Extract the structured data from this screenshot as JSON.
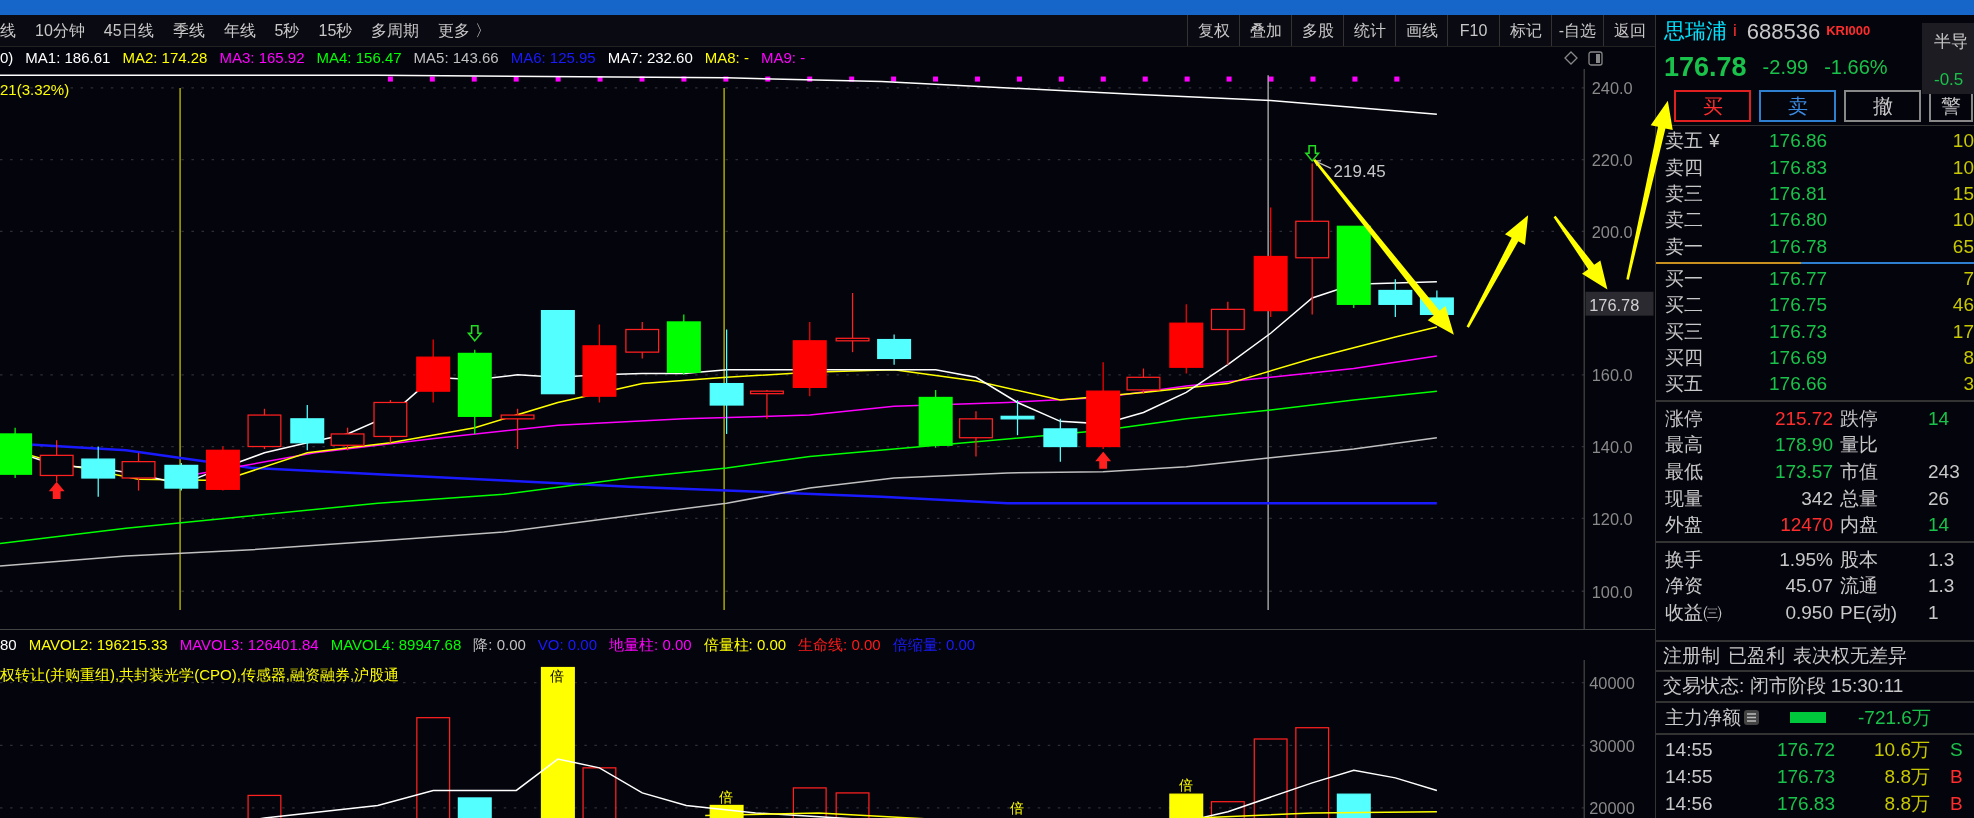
{
  "toolbar": {
    "periods": [
      "线",
      "10分钟",
      "45日线",
      "季线",
      "年线",
      "5秒",
      "15秒",
      "多周期",
      "更多 〉"
    ],
    "buttons": [
      "复权",
      "叠加",
      "多股",
      "统计",
      "画线",
      "F10",
      "标记",
      "-自选",
      "返回"
    ]
  },
  "ma_legend": [
    {
      "label": "0)",
      "color": "#ffffff"
    },
    {
      "label": "MA1: 186.61",
      "color": "#ffffff"
    },
    {
      "label": "MA2: 174.28",
      "color": "#ffff00"
    },
    {
      "label": "MA3: 165.92",
      "color": "#ff00ff"
    },
    {
      "label": "MA4: 156.47",
      "color": "#00ff00"
    },
    {
      "label": "MA5: 143.66",
      "color": "#c0c0c0"
    },
    {
      "label": "MA6: 125.95",
      "color": "#1a1aff"
    },
    {
      "label": "MA7: 232.60",
      "color": "#ffffff"
    },
    {
      "label": "MA8: -",
      "color": "#ffff00"
    },
    {
      "label": "MA9: -",
      "color": "#ff00ff"
    }
  ],
  "price_chart": {
    "change_label": "21(3.32%)",
    "high_label": "219.45",
    "last_price_tag": "176.78",
    "axis_labels": [
      "240.0",
      "220.0",
      "200.0",
      "160.0",
      "140.0",
      "120.0",
      "100.0"
    ]
  },
  "volume_legend": [
    {
      "label": "80",
      "color": "#ffffff"
    },
    {
      "label": "MAVOL2: 196215.33",
      "color": "#ffff00"
    },
    {
      "label": "MAVOL3: 126401.84",
      "color": "#ff00ff"
    },
    {
      "label": "MAVOL4: 89947.68",
      "color": "#00ff00"
    },
    {
      "label": "降: 0.00",
      "color": "#c0c0c0"
    },
    {
      "label": "VO: 0.00",
      "color": "#1a1aff"
    },
    {
      "label": "地量柱: 0.00",
      "color": "#ff00ff"
    },
    {
      "label": "倍量柱: 0.00",
      "color": "#ffff00"
    },
    {
      "label": "生命线: 0.00",
      "color": "#ff1a1a"
    },
    {
      "label": "倍缩量: 0.00",
      "color": "#1a1aff"
    }
  ],
  "concepts": "权转让(并购重组),共封装光学(CPO),传感器,融资融券,沪股通",
  "volume_chart": {
    "bar_labels": [
      "倍",
      "倍",
      "倍",
      "倍"
    ],
    "axis_labels": [
      "40000",
      "30000",
      "20000"
    ]
  },
  "quote": {
    "name": "思瑞浦",
    "name_mark": "i",
    "code": "688536",
    "tag": "KRI000",
    "sector": "半导",
    "sector_change": "-0.5",
    "price": "176.78",
    "change": "-2.99",
    "change_pct": "-1.66%"
  },
  "trade_buttons": [
    {
      "label": "买",
      "kind": "buy"
    },
    {
      "label": "卖",
      "kind": "sell"
    },
    {
      "label": "撤",
      "kind": "cancel"
    },
    {
      "label": "警",
      "kind": "alert"
    }
  ],
  "order_book": {
    "asks": [
      {
        "label": "卖五",
        "currency": "¥",
        "price": "176.86",
        "volume": "10"
      },
      {
        "label": "卖四",
        "price": "176.83",
        "volume": "10"
      },
      {
        "label": "卖三",
        "price": "176.81",
        "volume": "15"
      },
      {
        "label": "卖二",
        "price": "176.80",
        "volume": "10"
      },
      {
        "label": "卖一",
        "price": "176.78",
        "volume": "65"
      }
    ],
    "bids": [
      {
        "label": "买一",
        "price": "176.77",
        "volume": "7"
      },
      {
        "label": "买二",
        "price": "176.75",
        "volume": "46"
      },
      {
        "label": "买三",
        "price": "176.73",
        "volume": "17"
      },
      {
        "label": "买四",
        "price": "176.69",
        "volume": "8"
      },
      {
        "label": "买五",
        "price": "176.66",
        "volume": "3"
      }
    ]
  },
  "stats": [
    [
      {
        "label": "涨停",
        "value": "215.72",
        "color": "#ff2d2d"
      },
      {
        "label": "跌停",
        "value": "14",
        "color": "#19c24a"
      }
    ],
    [
      {
        "label": "最高",
        "value": "178.90",
        "color": "#19c24a"
      },
      {
        "label": "量比"
      }
    ],
    [
      {
        "label": "最低",
        "value": "173.57",
        "color": "#19c24a"
      },
      {
        "label": "市值",
        "value": "243",
        "color": "#c8c8c8"
      }
    ],
    [
      {
        "label": "现量",
        "value": "342",
        "color": "#c8c8c8"
      },
      {
        "label": "总量",
        "value": "26",
        "color": "#c8c8c8"
      }
    ],
    [
      {
        "label": "外盘",
        "value": "12470",
        "color": "#ff2d2d"
      },
      {
        "label": "内盘",
        "value": "14",
        "color": "#19c24a"
      }
    ]
  ],
  "stats2": [
    [
      {
        "label": "换手",
        "value": "1.95%",
        "color": "#c8c8c8"
      },
      {
        "label": "股本",
        "value": "1.3",
        "color": "#c8c8c8"
      }
    ],
    [
      {
        "label": "净资",
        "value": "45.07",
        "color": "#c8c8c8"
      },
      {
        "label": "流通",
        "value": "1.3",
        "color": "#c8c8c8"
      }
    ],
    [
      {
        "label": "收益㈢",
        "value": "0.950",
        "color": "#c8c8c8"
      },
      {
        "label": "PE(动)",
        "value": "1",
        "color": "#c8c8c8"
      }
    ]
  ],
  "badges": [
    "注册制",
    "已盈利",
    "表决权无差异"
  ],
  "trading_status": "交易状态: 闭市阶段 15:30:11",
  "main_net": {
    "label": "主力净额",
    "value": "-721.6万"
  },
  "ticks": [
    {
      "time": "14:55",
      "price": "176.72",
      "volume": "10.6万",
      "side": "S",
      "kind": "sell"
    },
    {
      "time": "14:55",
      "price": "176.73",
      "volume": "8.8万",
      "side": "B",
      "kind": "buy"
    },
    {
      "time": "14:56",
      "price": "176.83",
      "volume": "8.8万",
      "side": "B",
      "kind": "buy"
    }
  ]
}
